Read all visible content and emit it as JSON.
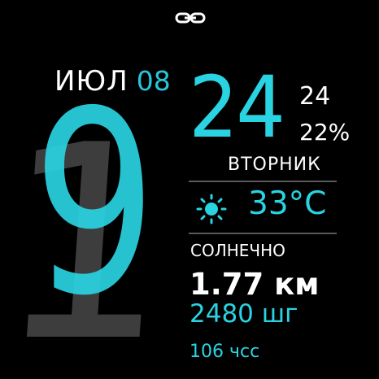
{
  "date": {
    "month": "ИЮЛ",
    "day": "08",
    "weekday": "ВТОРНИК"
  },
  "time": {
    "hour": "19",
    "hour_tens": "1",
    "hour_ones": "9",
    "minutes": "24",
    "seconds": "24"
  },
  "status": {
    "battery": "22%",
    "link_icon": "link-icon"
  },
  "weather": {
    "icon": "sun-icon",
    "temperature": "33°C",
    "condition": "СОЛНЕЧНО"
  },
  "activity": {
    "distance": "1.77 км",
    "steps": "2480 шг",
    "heart_rate": "106 чсс"
  },
  "colors": {
    "accent": "#2ad3e1",
    "background": "#000000",
    "ghost_digit": "#3d3d3d",
    "divider": "#5a5a5a"
  }
}
